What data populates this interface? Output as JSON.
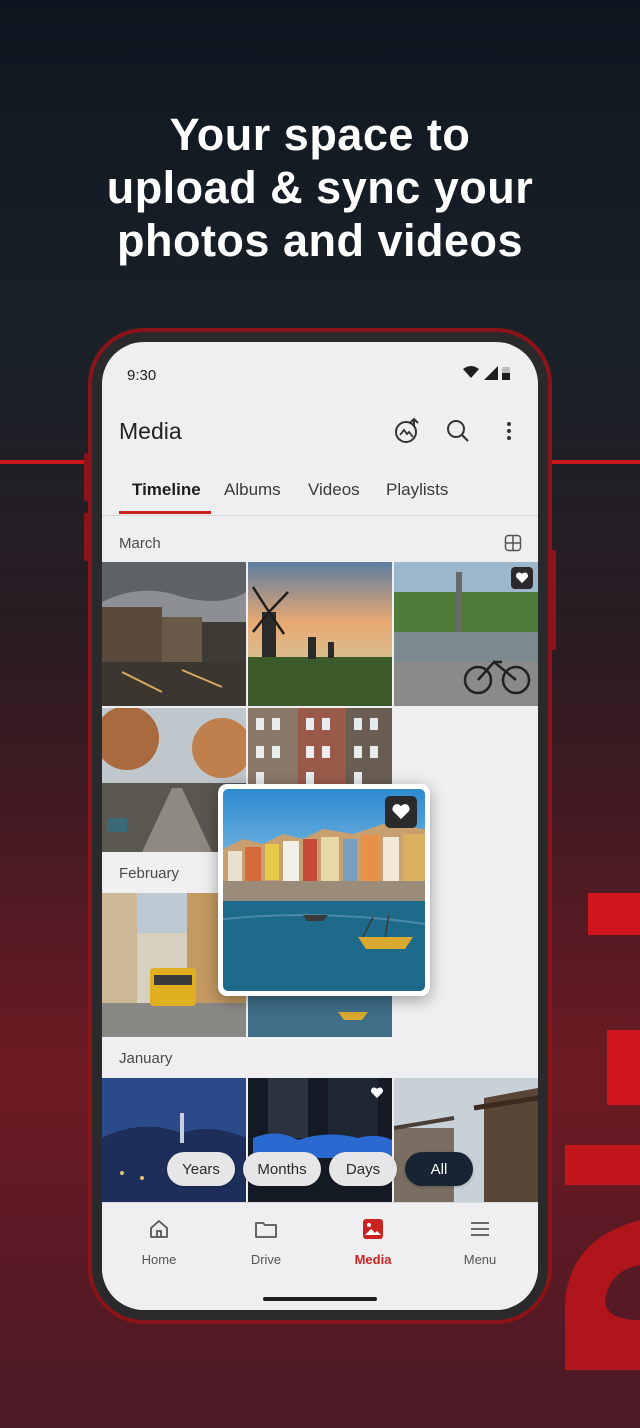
{
  "promo": {
    "headline_line1": "Your space to",
    "headline_line2": "upload & sync your",
    "headline_line3": "photos and videos",
    "accent_color": "#cc2121"
  },
  "status_bar": {
    "time": "9:30"
  },
  "app_bar": {
    "title": "Media",
    "icons": [
      "photo-sync-icon",
      "search-icon",
      "more-vert-icon"
    ]
  },
  "tabs": [
    {
      "label": "Timeline",
      "active": true
    },
    {
      "label": "Albums",
      "active": false
    },
    {
      "label": "Videos",
      "active": false
    },
    {
      "label": "Playlists",
      "active": false
    }
  ],
  "sections": [
    {
      "label": "March"
    },
    {
      "label": "February"
    },
    {
      "label": "January"
    }
  ],
  "zoom_pills": [
    {
      "label": "Years",
      "active": false
    },
    {
      "label": "Months",
      "active": false
    },
    {
      "label": "Days",
      "active": false
    },
    {
      "label": "All",
      "active": true
    }
  ],
  "bottom_nav": [
    {
      "label": "Home",
      "icon": "home-icon",
      "active": false
    },
    {
      "label": "Drive",
      "icon": "folder-icon",
      "active": false
    },
    {
      "label": "Media",
      "icon": "image-icon",
      "active": true
    },
    {
      "label": "Menu",
      "icon": "menu-icon",
      "active": false
    }
  ]
}
